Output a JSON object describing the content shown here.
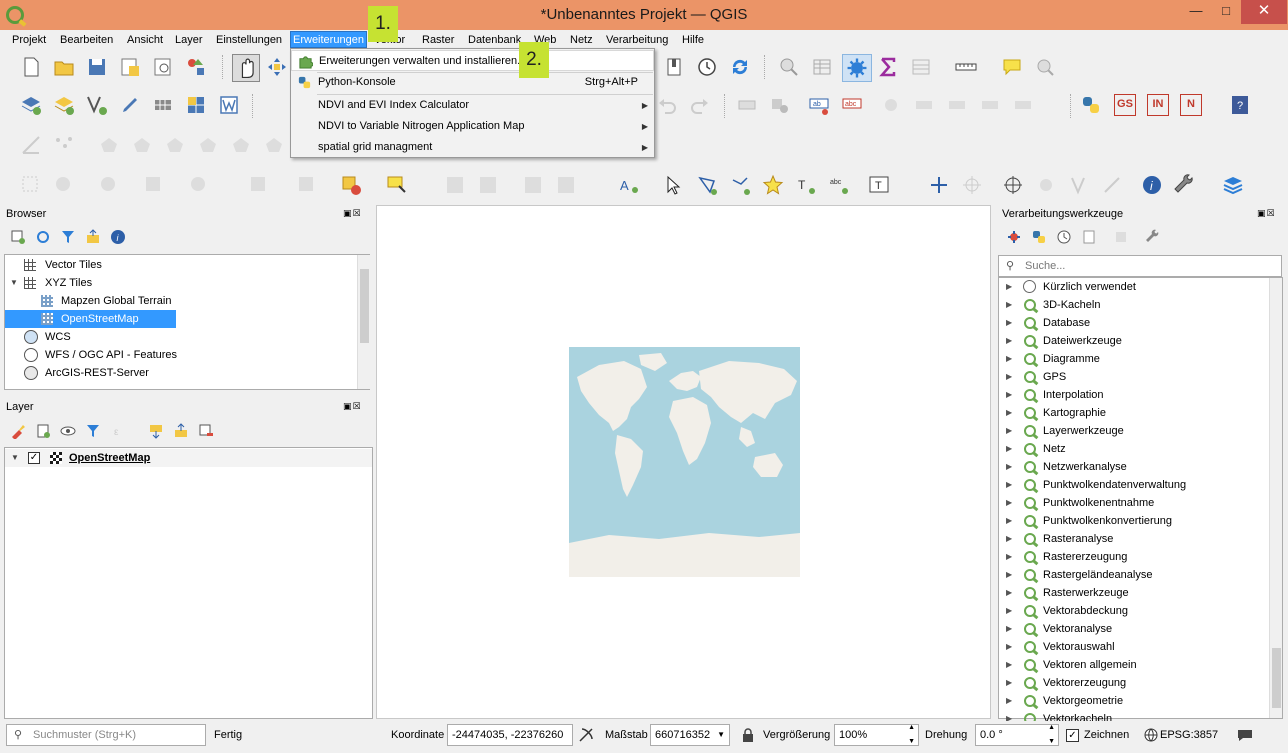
{
  "window": {
    "title": "*Unbenanntes Projekt — QGIS"
  },
  "menubar": [
    "Projekt",
    "Bearbeiten",
    "Ansicht",
    "Layer",
    "Einstellungen",
    "Erweiterungen",
    "Vektor",
    "Raster",
    "Datenbank",
    "Web",
    "Netz",
    "Verarbeitung",
    "Hilfe"
  ],
  "erweiterungen_menu": {
    "items": [
      {
        "label": "Erweiterungen verwalten und installieren...",
        "shortcut": "",
        "submenu": false
      },
      {
        "label": "Python-Konsole",
        "shortcut": "Strg+Alt+P",
        "submenu": false
      },
      {
        "label": "NDVI and EVI Index Calculator",
        "shortcut": "",
        "submenu": true
      },
      {
        "label": "NDVI to Variable Nitrogen Application Map",
        "shortcut": "",
        "submenu": true
      },
      {
        "label": "spatial grid managment",
        "shortcut": "",
        "submenu": true
      }
    ]
  },
  "badges": {
    "step1": "1.",
    "step2": "2."
  },
  "plugin_buttons": {
    "gs": "GS",
    "in": "IN",
    "n": "N"
  },
  "browser": {
    "title": "Browser",
    "items": [
      {
        "label": "Vector Tiles",
        "depth": 0
      },
      {
        "label": "XYZ Tiles",
        "depth": 0
      },
      {
        "label": "Mapzen Global Terrain",
        "depth": 1
      },
      {
        "label": "OpenStreetMap",
        "depth": 1,
        "selected": true
      },
      {
        "label": "WCS",
        "depth": 0
      },
      {
        "label": "WFS / OGC API - Features",
        "depth": 0
      },
      {
        "label": "ArcGIS-REST-Server",
        "depth": 0
      }
    ]
  },
  "layers": {
    "title": "Layer",
    "items": [
      {
        "label": "OpenStreetMap",
        "checked": true
      }
    ]
  },
  "processing": {
    "title": "Verarbeitungswerkzeuge",
    "search_placeholder": "Suche...",
    "recent": "Kürzlich verwendet",
    "groups": [
      "3D-Kacheln",
      "Database",
      "Dateiwerkzeuge",
      "Diagramme",
      "GPS",
      "Interpolation",
      "Kartographie",
      "Layerwerkzeuge",
      "Netz",
      "Netzwerkanalyse",
      "Punktwolkendatenverwaltung",
      "Punktwolkenentnahme",
      "Punktwolkenkonvertierung",
      "Rasteranalyse",
      "Rastererzeugung",
      "Rastergeländeanalyse",
      "Rasterwerkzeuge",
      "Vektorabdeckung",
      "Vektoranalyse",
      "Vektorauswahl",
      "Vektoren allgemein",
      "Vektorerzeugung",
      "Vektorgeometrie",
      "Vektorkacheln"
    ]
  },
  "statusbar": {
    "search_placeholder": "Suchmuster (Strg+K)",
    "status": "Fertig",
    "coord_label": "Koordinate",
    "coord_value": "-24474035, -22376260",
    "scale_label": "Maßstab",
    "scale_value": "660716352",
    "zoom_label": "Vergrößerung",
    "zoom_value": "100%",
    "rotation_label": "Drehung",
    "rotation_value": "0.0 °",
    "render_label": "Zeichnen",
    "crs": "EPSG:3857"
  },
  "colors": {
    "accent": "#3399ff",
    "titlebar": "#eb9467",
    "badge": "#c6e232",
    "qgis_green": "#6aa84f"
  }
}
